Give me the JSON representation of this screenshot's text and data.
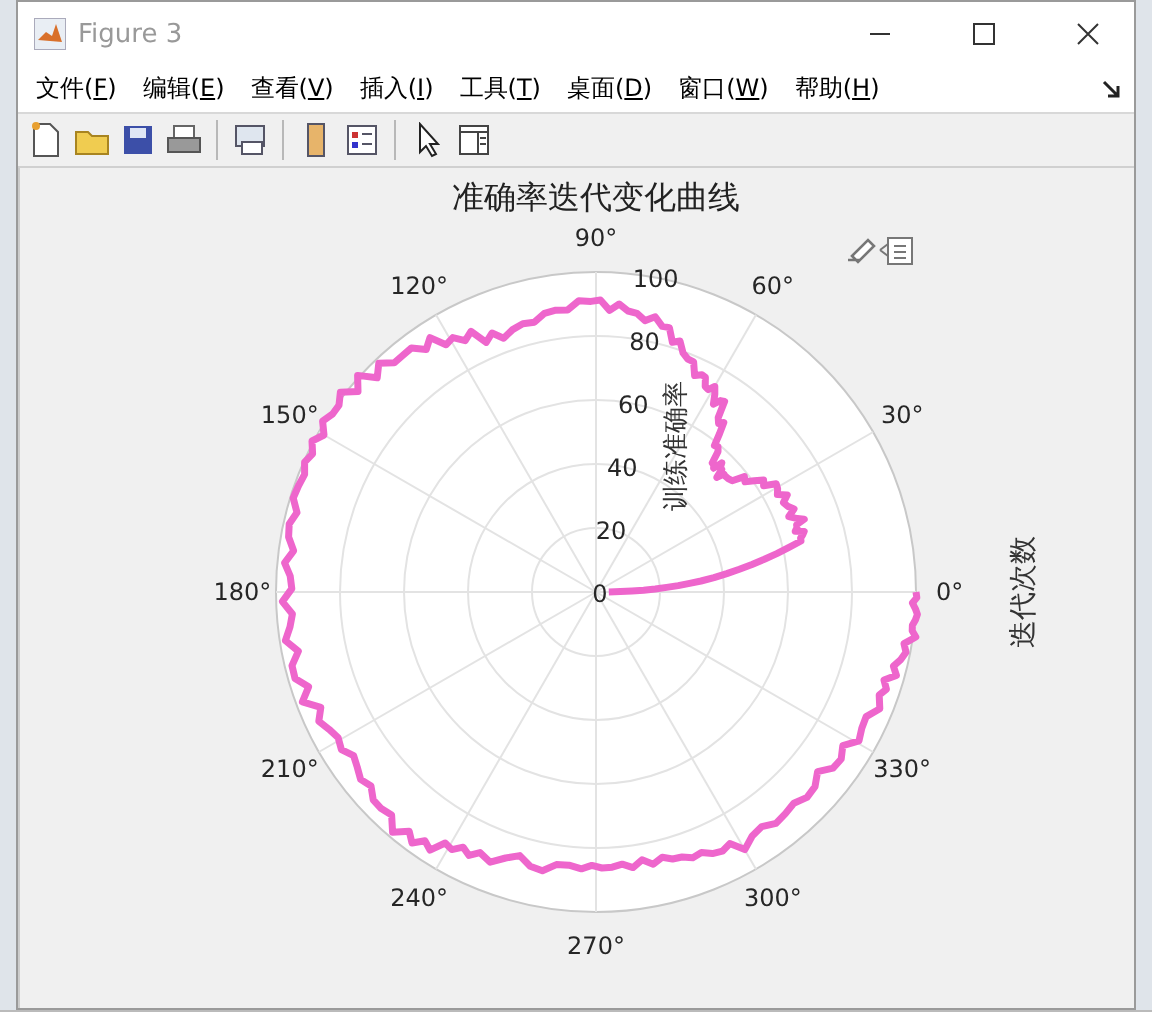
{
  "window": {
    "title": "Figure 3"
  },
  "menu": [
    "文件(F)",
    "编辑(E)",
    "查看(V)",
    "插入(I)",
    "工具(T)",
    "桌面(D)",
    "窗口(W)",
    "帮助(H)"
  ],
  "figure": {
    "title": "准确率迭代变化曲线",
    "radial_label": "训练准确率",
    "angle_label": "迭代次数",
    "angle_ticks": [
      "0°",
      "30°",
      "60°",
      "90°",
      "120°",
      "150°",
      "180°",
      "210°",
      "240°",
      "270°",
      "300°",
      "330°"
    ],
    "radius_ticks": [
      "100",
      "80",
      "60",
      "40",
      "20",
      "0"
    ]
  }
}
